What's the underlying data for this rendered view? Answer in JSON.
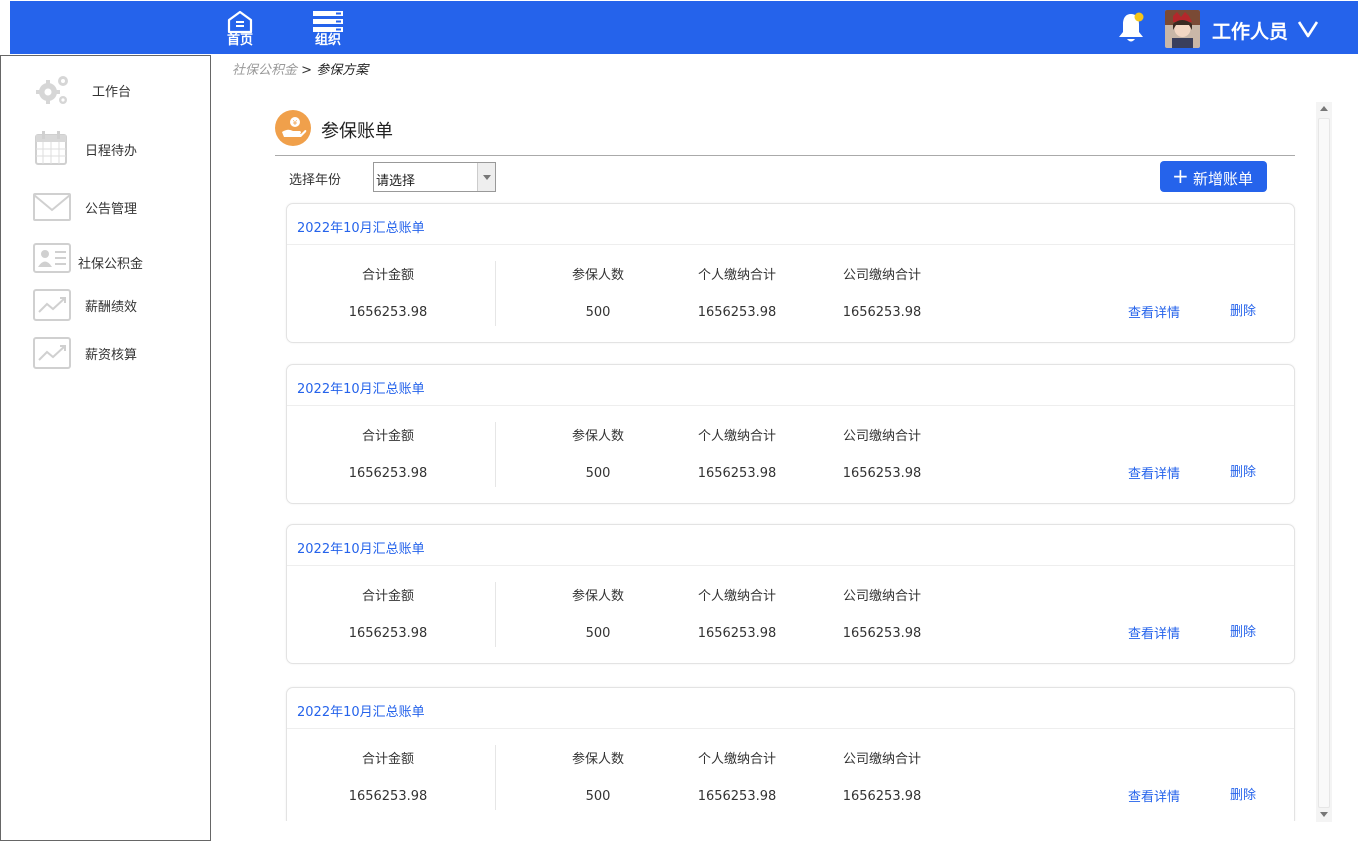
{
  "topbar": {
    "home_label": "首页",
    "org_label": "组织",
    "user_name": "工作人员",
    "colors": {
      "bar": "#2563eb",
      "notification_dot": "#f5c518"
    }
  },
  "sidebar": {
    "items": [
      {
        "label": "工作台",
        "icon": "gears-icon"
      },
      {
        "label": "日程待办",
        "icon": "calendar-icon"
      },
      {
        "label": "公告管理",
        "icon": "envelope-icon"
      },
      {
        "label": "社保公积金",
        "icon": "id-card-icon"
      },
      {
        "label": "薪酬绩效",
        "icon": "trend-chart-icon"
      },
      {
        "label": "薪资核算",
        "icon": "trend-chart-icon"
      }
    ]
  },
  "breadcrumb": {
    "parent": "社保公积金",
    "separator": " > ",
    "current": "参保方案"
  },
  "panel": {
    "title": "参保账单",
    "year_label": "选择年份",
    "year_select_value": "请选择",
    "add_button": "新增账单"
  },
  "columns": {
    "total": "合计金额",
    "insured": "参保人数",
    "personal": "个人缴纳合计",
    "company": "公司缴纳合计"
  },
  "bills": [
    {
      "title": "2022年10月汇总账单",
      "total": "1656253.98",
      "insured": "500",
      "personal": "1656253.98",
      "company": "1656253.98",
      "detail": "查看详情",
      "delete": "删除"
    },
    {
      "title": "2022年10月汇总账单",
      "total": "1656253.98",
      "insured": "500",
      "personal": "1656253.98",
      "company": "1656253.98",
      "detail": "查看详情",
      "delete": "删除"
    },
    {
      "title": "2022年10月汇总账单",
      "total": "1656253.98",
      "insured": "500",
      "personal": "1656253.98",
      "company": "1656253.98",
      "detail": "查看详情",
      "delete": "删除"
    },
    {
      "title": "2022年10月汇总账单",
      "total": "1656253.98",
      "insured": "500",
      "personal": "1656253.98",
      "company": "1656253.98",
      "detail": "查看详情",
      "delete": "删除"
    }
  ]
}
